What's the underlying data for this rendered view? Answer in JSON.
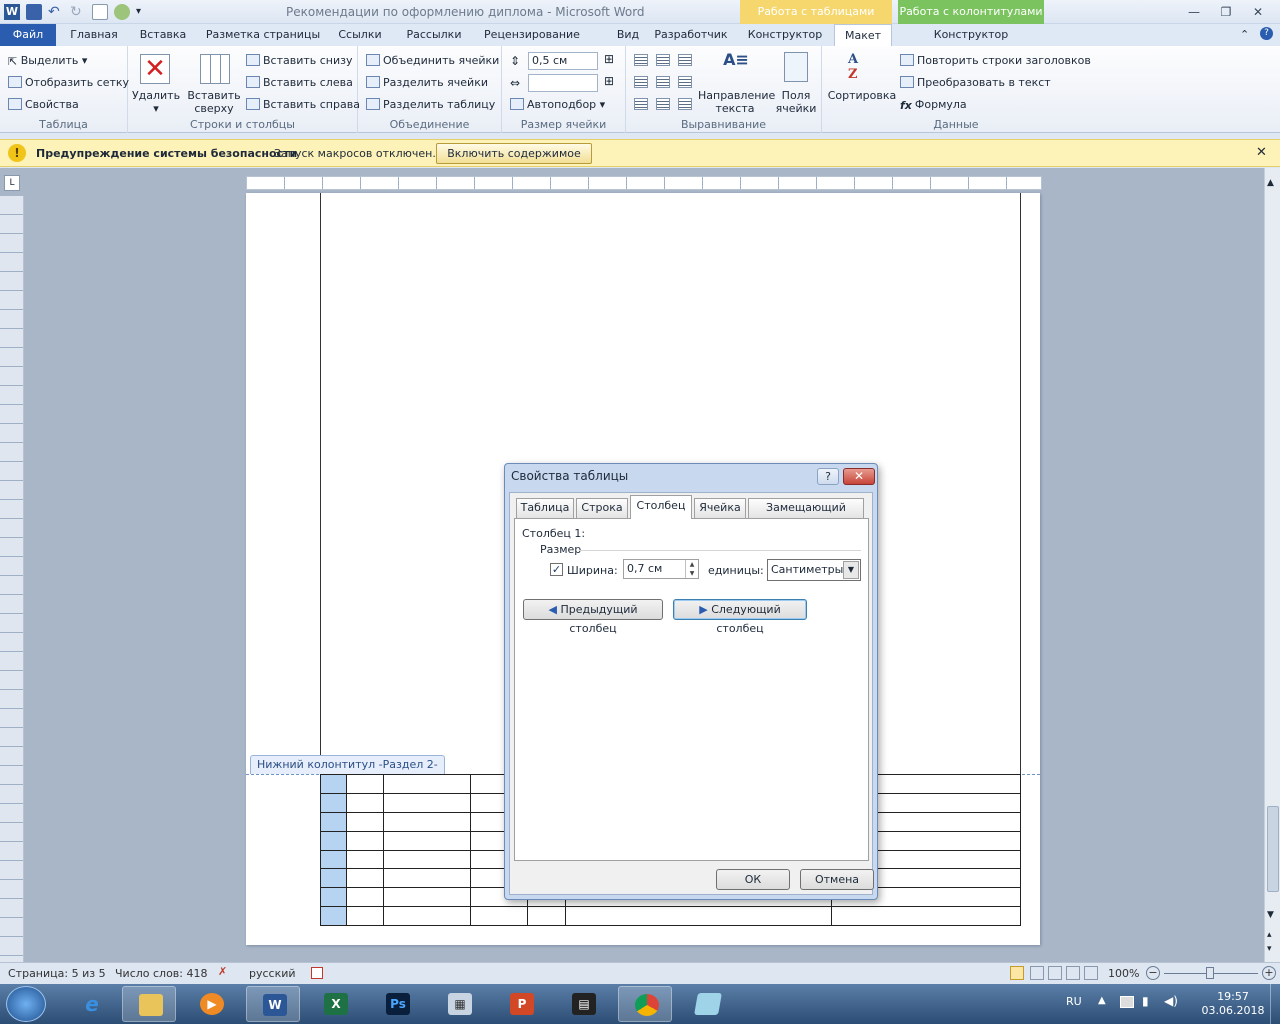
{
  "window": {
    "title": "Рекомендации по оформлению диплома  -  Microsoft Word",
    "context_groups": {
      "tables": "Работа с таблицами",
      "headers": "Работа с колонтитулами"
    },
    "colors": {
      "tables_ctx": "#f5d76e",
      "headers_ctx": "#7ac35f",
      "file_tab": "#2a5db0"
    }
  },
  "tabs": [
    "Файл",
    "Главная",
    "Вставка",
    "Разметка страницы",
    "Ссылки",
    "Рассылки",
    "Рецензирование",
    "Вид",
    "Разработчик",
    "Конструктор",
    "Макет",
    "Конструктор"
  ],
  "ribbon": {
    "table_group": {
      "label": "Таблица",
      "items": [
        "Выделить",
        "Отобразить сетку",
        "Свойства"
      ]
    },
    "rows_cols_group": {
      "label": "Строки и столбцы",
      "delete": "Удалить",
      "insert_above": "Вставить сверху",
      "items": [
        "Вставить снизу",
        "Вставить слева",
        "Вставить справа"
      ]
    },
    "merge_group": {
      "label": "Объединение",
      "items": [
        "Объединить ячейки",
        "Разделить ячейки",
        "Разделить таблицу"
      ]
    },
    "cell_size_group": {
      "label": "Размер ячейки",
      "height": "0,5 см",
      "width": "",
      "autofit": "Автоподбор"
    },
    "align_group": {
      "label": "Выравнивание",
      "text_direction": "Направление текста",
      "cell_margins": "Поля ячейки"
    },
    "data_group": {
      "label": "Данные",
      "sort": "Сортировка",
      "items": [
        "Повторить строки заголовков",
        "Преобразовать в текст",
        "Формула"
      ]
    }
  },
  "security_bar": {
    "title": "Предупреждение системы безопасности",
    "message": "Запуск макросов отключен.",
    "button": "Включить содержимое"
  },
  "document": {
    "footer_label": "Нижний колонтитул -Раздел 2-"
  },
  "dialog": {
    "title": "Свойства таблицы",
    "tabs": [
      "Таблица",
      "Строка",
      "Столбец",
      "Ячейка",
      "Замещающий текст"
    ],
    "active_tab": "Столбец",
    "column_label": "Столбец 1:",
    "size_label": "Размер",
    "width_checkbox_label": "Ширина:",
    "width_checked": true,
    "width_value": "0,7 см",
    "units_label": "единицы:",
    "units_value": "Сантиметры",
    "prev_button": "Предыдущий столбец",
    "next_button": "Следующий столбец",
    "ok": "ОК",
    "cancel": "Отмена"
  },
  "statusbar": {
    "page": "Страница: 5 из 5",
    "words": "Число слов: 418",
    "language": "русский",
    "zoom": "100%"
  },
  "taskbar": {
    "lang": "RU",
    "time": "19:57",
    "date": "03.06.2018"
  }
}
